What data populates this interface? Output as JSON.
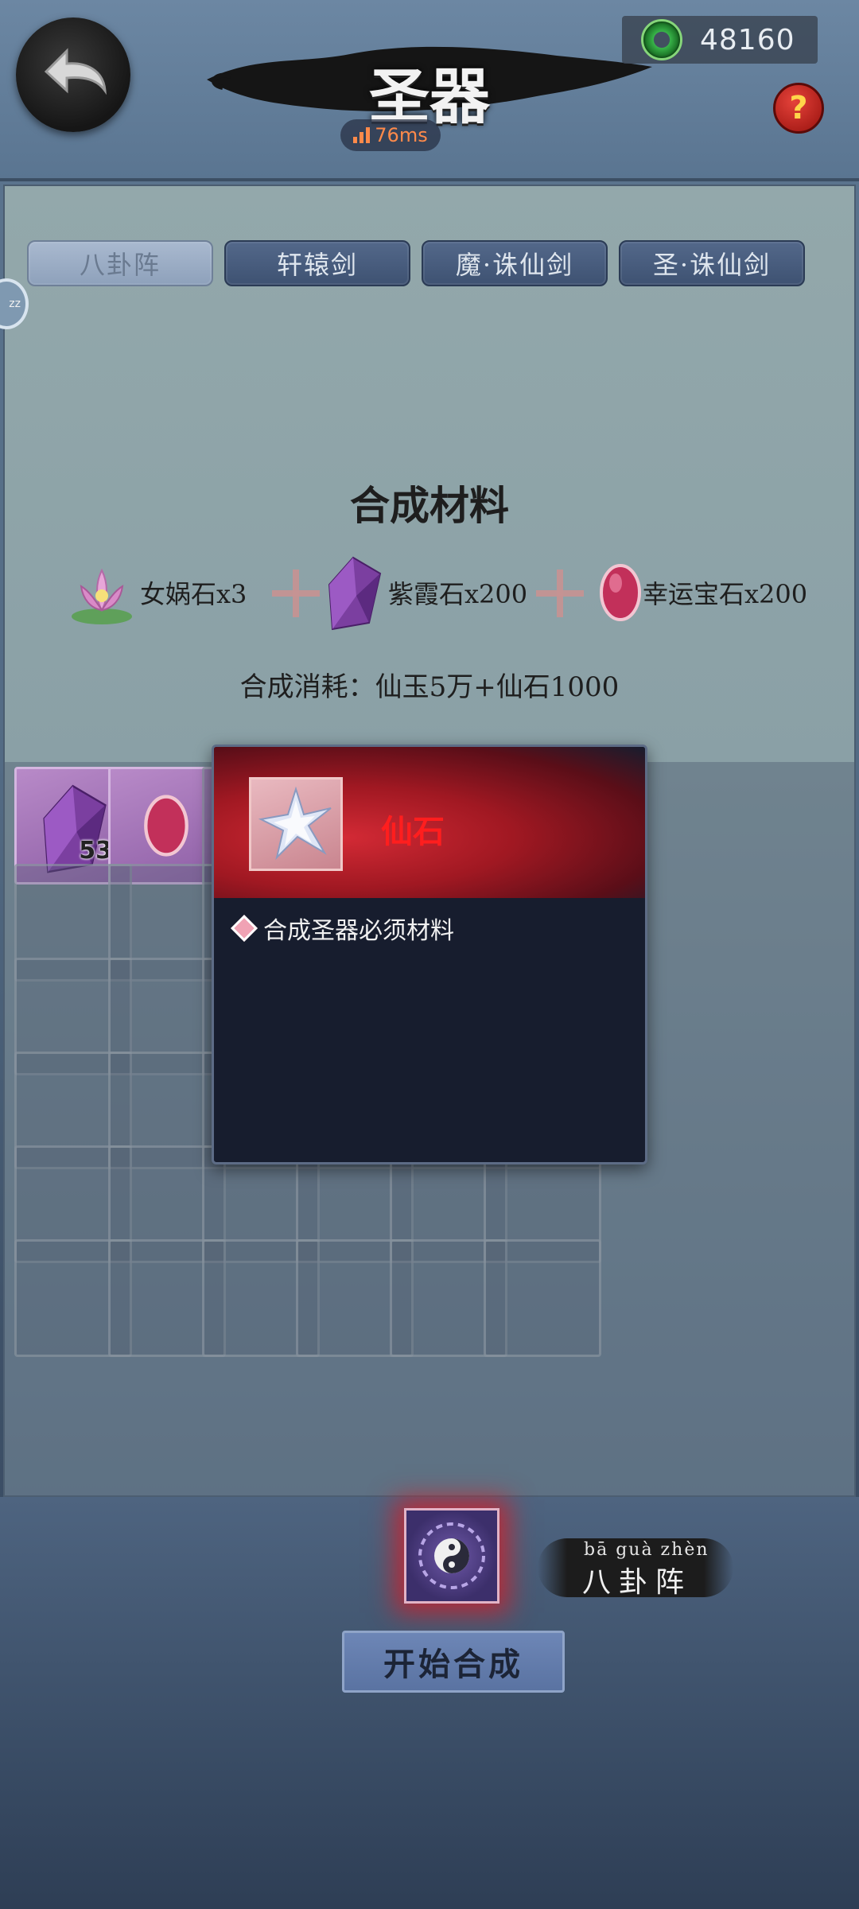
{
  "header": {
    "title": "圣器",
    "ping": "76ms",
    "currency_amount": "48160",
    "help_label": "?"
  },
  "tabs": [
    {
      "label": "八卦阵",
      "active": true
    },
    {
      "label": "轩辕剑",
      "active": false
    },
    {
      "label": "魔·诛仙剑",
      "active": false
    },
    {
      "label": "圣·诛仙剑",
      "active": false
    }
  ],
  "side_badge": "zz",
  "recipe": {
    "title": "合成材料",
    "materials": [
      {
        "label": "女娲石x3",
        "icon": "lotus-stone-icon"
      },
      {
        "label": "紫霞石x200",
        "icon": "purple-crystal-icon"
      },
      {
        "label": "幸运宝石x200",
        "icon": "lucky-gem-icon"
      }
    ],
    "cost": "合成消耗：仙玉5万+仙石1000"
  },
  "inventory": {
    "first_slot_count": "53"
  },
  "tooltip": {
    "item_name": "仙石",
    "description": "合成圣器必须材料"
  },
  "result": {
    "pinyin": "bā  guà zhèn",
    "name": "八卦阵"
  },
  "start_button": "开始合成",
  "colors": {
    "tooltip_name": "#ff1e1e",
    "accent_purple": "#8e5fa6",
    "glow_red": "#d21e28"
  }
}
